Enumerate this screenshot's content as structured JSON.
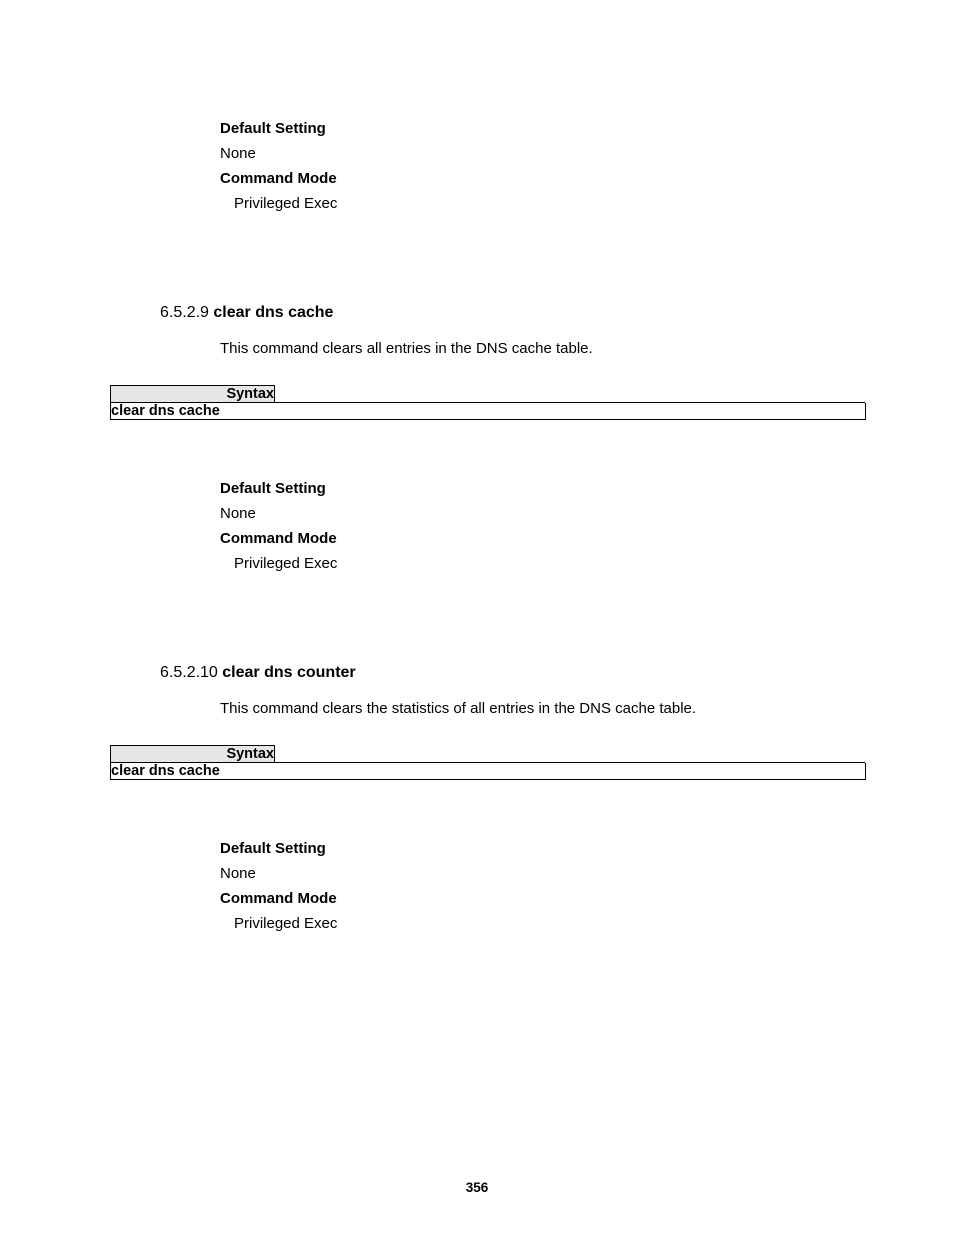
{
  "block1": {
    "defaultSettingLabel": "Default Setting",
    "defaultSettingValue": "None",
    "commandModeLabel": "Command Mode",
    "commandModeValue": "Privileged Exec"
  },
  "section1": {
    "number": "6.5.2.9 ",
    "title": "clear dns cache",
    "description": "This command clears all entries in the DNS cache table.",
    "syntaxLabel": "Syntax",
    "syntaxBody": "clear dns cache",
    "defaultSettingLabel": "Default Setting",
    "defaultSettingValue": "None",
    "commandModeLabel": "Command Mode",
    "commandModeValue": "Privileged Exec"
  },
  "section2": {
    "number": "6.5.2.10 ",
    "title": "clear dns counter",
    "description": "This command clears the statistics of all entries in the DNS cache table.",
    "syntaxLabel": "Syntax",
    "syntaxBody": "clear dns cache",
    "defaultSettingLabel": "Default Setting",
    "defaultSettingValue": "None",
    "commandModeLabel": "Command Mode",
    "commandModeValue": "Privileged Exec"
  },
  "pageNumber": "356"
}
